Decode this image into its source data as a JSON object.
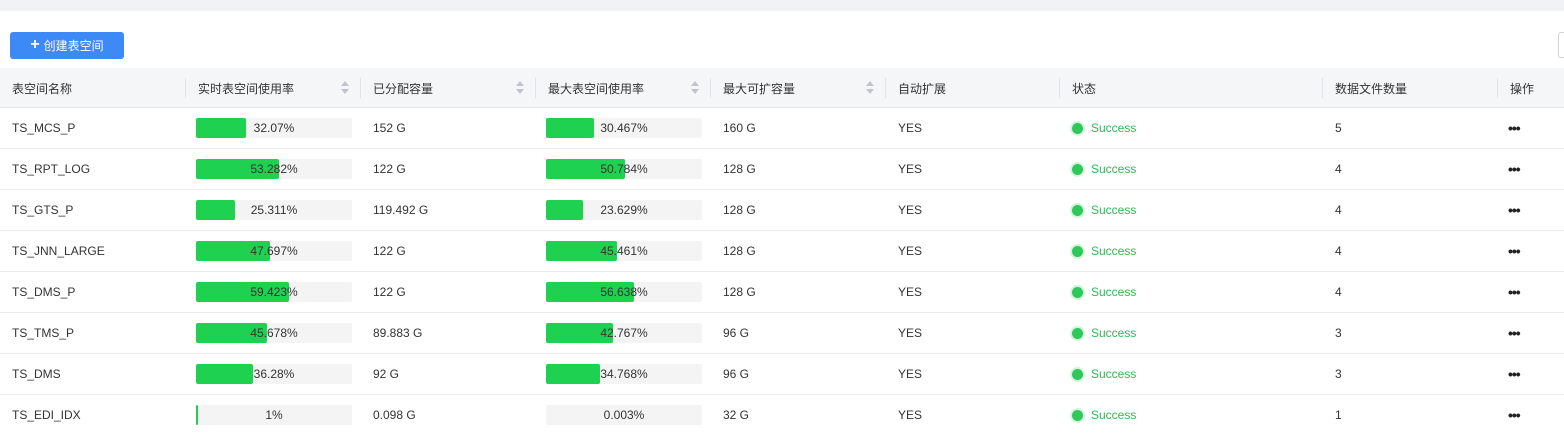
{
  "toolbar": {
    "create_label": "创建表空间",
    "create_icon": "plus-icon"
  },
  "colors": {
    "accent": "#3d8af7",
    "bar": "#1ed151",
    "success": "#2dbb52"
  },
  "table": {
    "columns": [
      "表空间名称",
      "实时表空间使用率",
      "已分配容量",
      "最大表空间使用率",
      "最大可扩容量",
      "自动扩展",
      "状态",
      "数据文件数量",
      "操作"
    ],
    "rows": [
      {
        "name": "TS_MCS_P",
        "realtime_usage": "32.07%",
        "realtime_pct": 32.07,
        "allocated": "152 G",
        "max_usage": "30.467%",
        "max_pct": 30.467,
        "max_extend": "160 G",
        "auto_extend": "YES",
        "status": "Success",
        "file_count": "5",
        "action": "•••"
      },
      {
        "name": "TS_RPT_LOG",
        "realtime_usage": "53.282%",
        "realtime_pct": 53.282,
        "allocated": "122 G",
        "max_usage": "50.784%",
        "max_pct": 50.784,
        "max_extend": "128 G",
        "auto_extend": "YES",
        "status": "Success",
        "file_count": "4",
        "action": "•••"
      },
      {
        "name": "TS_GTS_P",
        "realtime_usage": "25.311%",
        "realtime_pct": 25.311,
        "allocated": "119.492 G",
        "max_usage": "23.629%",
        "max_pct": 23.629,
        "max_extend": "128 G",
        "auto_extend": "YES",
        "status": "Success",
        "file_count": "4",
        "action": "•••"
      },
      {
        "name": "TS_JNN_LARGE",
        "realtime_usage": "47.697%",
        "realtime_pct": 47.697,
        "allocated": "122 G",
        "max_usage": "45.461%",
        "max_pct": 45.461,
        "max_extend": "128 G",
        "auto_extend": "YES",
        "status": "Success",
        "file_count": "4",
        "action": "•••"
      },
      {
        "name": "TS_DMS_P",
        "realtime_usage": "59.423%",
        "realtime_pct": 59.423,
        "allocated": "122 G",
        "max_usage": "56.638%",
        "max_pct": 56.638,
        "max_extend": "128 G",
        "auto_extend": "YES",
        "status": "Success",
        "file_count": "4",
        "action": "•••"
      },
      {
        "name": "TS_TMS_P",
        "realtime_usage": "45.678%",
        "realtime_pct": 45.678,
        "allocated": "89.883 G",
        "max_usage": "42.767%",
        "max_pct": 42.767,
        "max_extend": "96 G",
        "auto_extend": "YES",
        "status": "Success",
        "file_count": "3",
        "action": "•••"
      },
      {
        "name": "TS_DMS",
        "realtime_usage": "36.28%",
        "realtime_pct": 36.28,
        "allocated": "92 G",
        "max_usage": "34.768%",
        "max_pct": 34.768,
        "max_extend": "96 G",
        "auto_extend": "YES",
        "status": "Success",
        "file_count": "3",
        "action": "•••"
      },
      {
        "name": "TS_EDI_IDX",
        "realtime_usage": "1%",
        "realtime_pct": 1,
        "allocated": "0.098 G",
        "max_usage": "0.003%",
        "max_pct": 0.003,
        "max_extend": "32 G",
        "auto_extend": "YES",
        "status": "Success",
        "file_count": "1",
        "action": "•••"
      }
    ]
  }
}
